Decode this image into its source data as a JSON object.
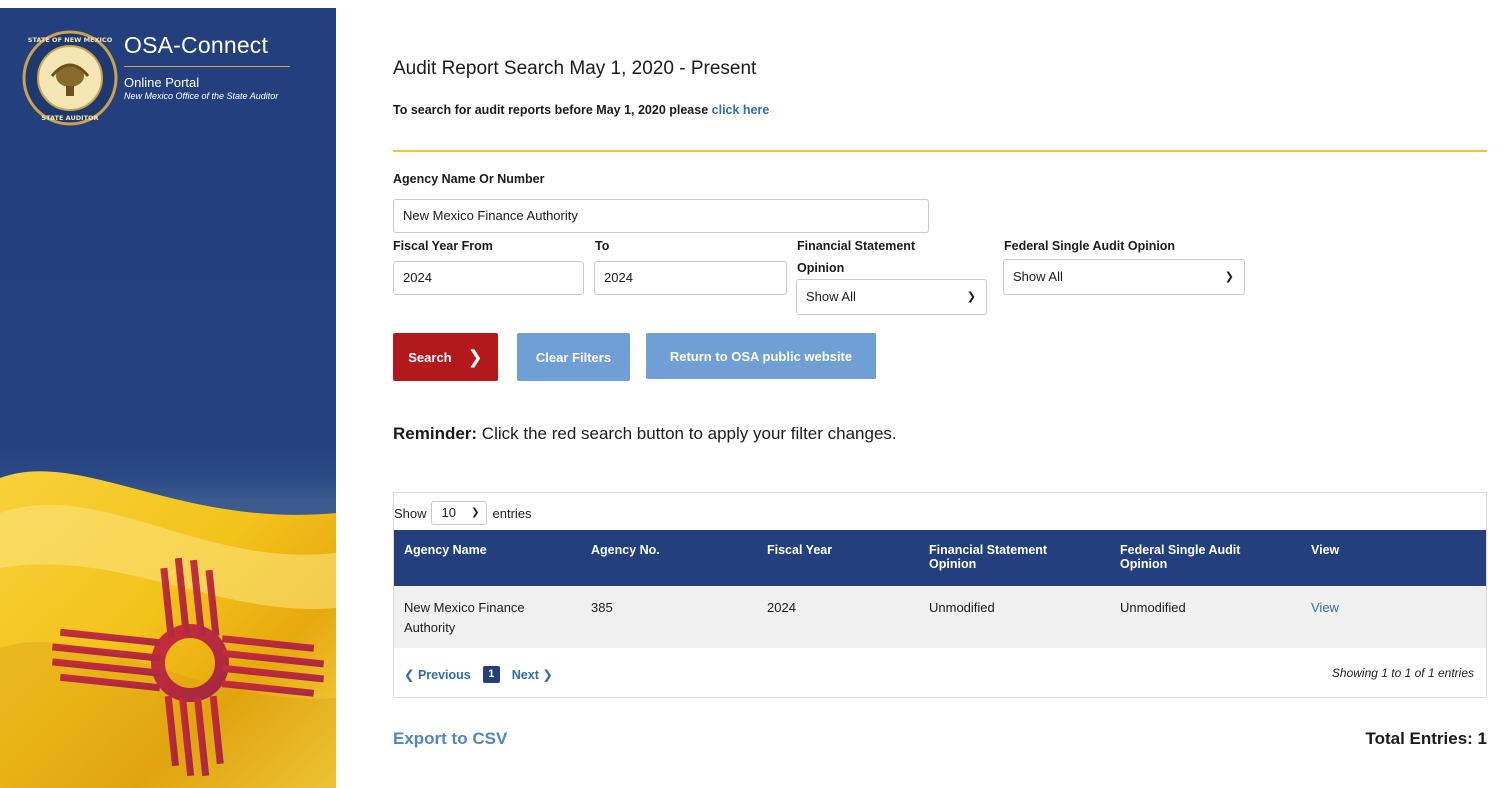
{
  "brand": {
    "title": "OSA-Connect",
    "subtitle": "Online Portal",
    "office": "New Mexico Office of the State Auditor",
    "seal_text": "THE STATE OF NEW MEXICO STATE AUDITOR"
  },
  "header": {
    "title": "Audit Report Search May 1, 2020 - Present",
    "subtitle_prefix": "To search for audit reports before May 1, 2020 please ",
    "subtitle_link": "click here"
  },
  "filters": {
    "agency_label": "Agency Name Or Number",
    "agency_value": "New Mexico Finance Authority",
    "fy_from_label": "Fiscal Year From",
    "fy_from_value": "2024",
    "fy_to_label": "To",
    "fy_to_value": "2024",
    "fs_opinion_label_1": "Financial Statement",
    "fs_opinion_label_2": "Opinion",
    "fs_opinion_value": "Show All",
    "fsa_opinion_label": "Federal Single Audit Opinion",
    "fsa_opinion_value": "Show All"
  },
  "buttons": {
    "search": "Search",
    "clear": "Clear Filters",
    "return": "Return to OSA public website"
  },
  "reminder": {
    "bold": "Reminder:",
    "text": " Click the red search button to apply your filter changes."
  },
  "table": {
    "show_label": "Show",
    "page_size": "10",
    "entries_label": "entries",
    "headers": [
      [
        "Agency Name"
      ],
      [
        "Agency No."
      ],
      [
        "Fiscal Year"
      ],
      [
        "Financial Statement",
        "Opinion"
      ],
      [
        "Federal Single Audit",
        "Opinion"
      ],
      [
        "View"
      ]
    ],
    "rows": [
      {
        "agency_name_1": "New Mexico Finance",
        "agency_name_2": "Authority",
        "agency_no": "385",
        "fiscal_year": "2024",
        "fs_opinion": "Unmodified",
        "fsa_opinion": "Unmodified",
        "view": "View"
      }
    ],
    "prev": "Previous",
    "page": "1",
    "next": "Next",
    "showing": "Showing 1 to 1 of 1 entries"
  },
  "footer": {
    "export": "Export to CSV",
    "total": "Total Entries: 1"
  },
  "colors": {
    "navy": "#243f7d",
    "red": "#b3191c",
    "light_blue": "#6f9fd4",
    "gold": "#f5c13a",
    "link": "#2e6db4"
  }
}
